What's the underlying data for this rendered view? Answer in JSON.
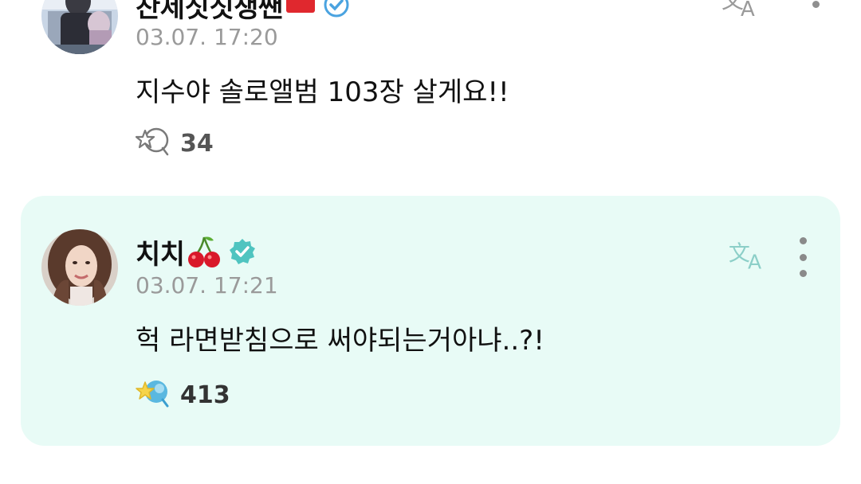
{
  "comments": [
    {
      "author": "찬제짓짓쟁짼",
      "author_emoji": "red-flag-emoji",
      "verified_icon": "verified-badge-icon",
      "timestamp": "03.07. 17:20",
      "text": "지수야 솔로앨범 103장 살게요!!",
      "reaction_icon": "star-bubble-outline-icon",
      "reaction_count": "34",
      "translate_icon": "translate-icon",
      "more_icon": "more-vertical-icon"
    },
    {
      "author": "치치",
      "author_emoji": "cherry-emoji",
      "verified_icon": "verified-badge-icon",
      "timestamp": "03.07. 17:21",
      "text": "헉 라면받침으로 써야되는거아냐..?!",
      "reaction_icon": "star-bubble-filled-icon",
      "reaction_count": "413",
      "translate_icon": "translate-icon",
      "more_icon": "more-vertical-icon",
      "highlighted": true
    }
  ],
  "colors": {
    "highlight_bg": "#e8fbf6",
    "verified": "#4fc4c0",
    "timestamp": "#9a9a9a",
    "icon_gray": "#8a8a8a",
    "icon_teal": "#8ccfc8"
  }
}
